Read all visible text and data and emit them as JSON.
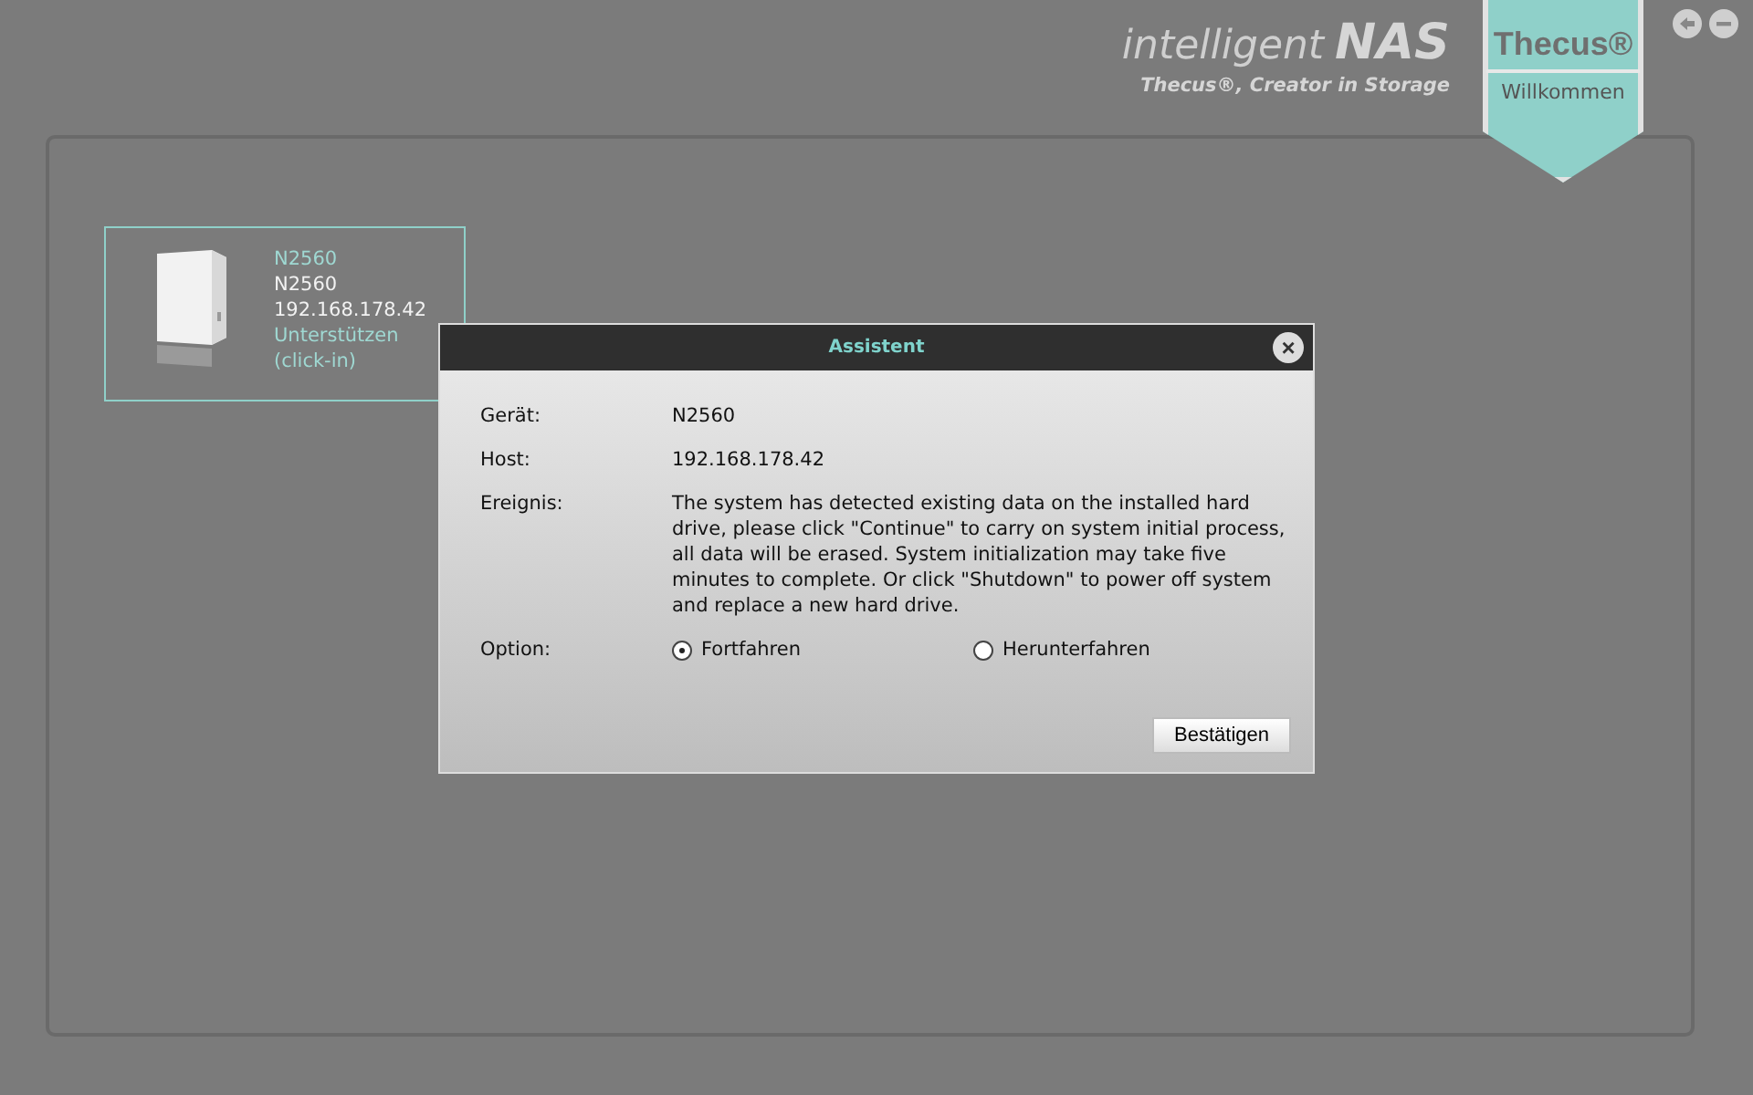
{
  "header": {
    "logo_word": "intelligent",
    "logo_nas": "NAS",
    "tagline": "Thecus®, Creator in Storage",
    "badge_brand": "Thecus®",
    "badge_label": "Willkommen"
  },
  "devices": [
    {
      "name": "N2560",
      "model": "N2560",
      "ip": "192.168.178.42",
      "link": "Unterstützen (click-in)"
    }
  ],
  "dialog": {
    "title": "Assistent",
    "close": "×",
    "fields": [
      {
        "label": "Gerät:",
        "value": "N2560"
      },
      {
        "label": "Host:",
        "value": "192.168.178.42"
      },
      {
        "label": "Ereignis:",
        "value": "The system has detected existing data on the installed hard drive, please click \"Continue\" to carry on system initial process, all data will be erased. System initialization may take five minutes to complete. Or click \"Shutdown\" to power off system and replace a new hard drive."
      }
    ],
    "option_label": "Option:",
    "options": [
      {
        "label": "Fortfahren",
        "selected": true
      },
      {
        "label": "Herunterfahren",
        "selected": false
      }
    ],
    "confirm": "Bestätigen"
  }
}
